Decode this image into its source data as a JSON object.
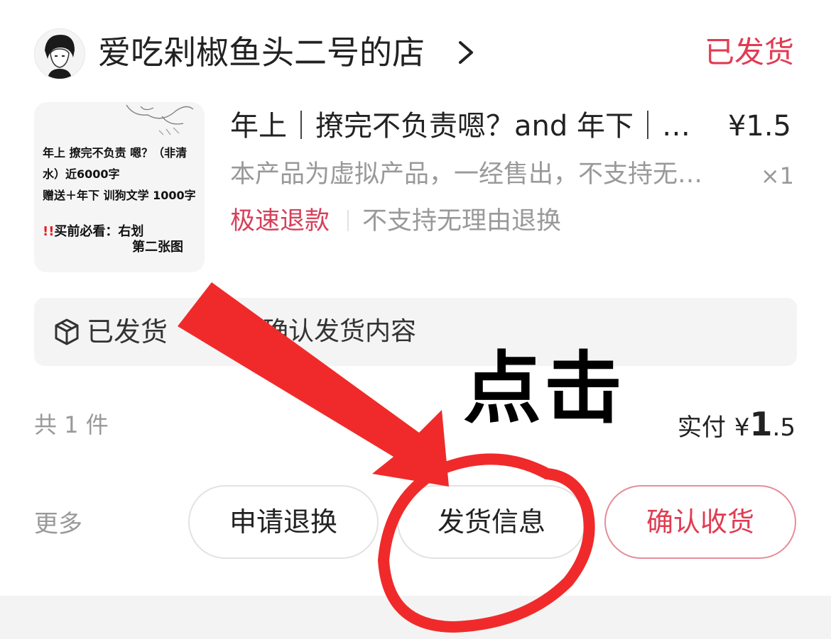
{
  "header": {
    "shop_name": "爱吃剁椒鱼头二号的店",
    "order_status": "已发货",
    "avatar_icon": "avatar-portrait"
  },
  "product": {
    "title": "年上｜撩完不负责嗯？and 年下｜…",
    "price": "¥1.5",
    "description": "本产品为虚拟产品，一经售出，不支持无…",
    "quantity": "×1",
    "tag_fast_refund": "极速退款",
    "tag_no_return": "不支持无理由退换",
    "thumbnail": {
      "line1": "年上 撩完不负责 嗯？（非清",
      "line2": "水）近6000字",
      "line3": "赠送＋年下 训狗文学 1000字",
      "warn_mark": "!!",
      "line4": "买前必看：右划",
      "line5": "第二张图"
    }
  },
  "shipment_banner": {
    "status": "已发货",
    "text": "确认发货内容",
    "icon": "package-box-icon"
  },
  "totals": {
    "count": "共 1 件",
    "paid_label": "实付",
    "currency": "¥",
    "amount_int": "1",
    "amount_dec": ".5"
  },
  "actions": {
    "more": "更多",
    "refund": "申请退换",
    "ship_info": "发货信息",
    "confirm": "确认收货"
  },
  "annotation": {
    "label": "点击"
  },
  "colors": {
    "accent_red": "#e03c52",
    "annotation_red": "#f02a2a",
    "muted_gray": "#999999"
  }
}
